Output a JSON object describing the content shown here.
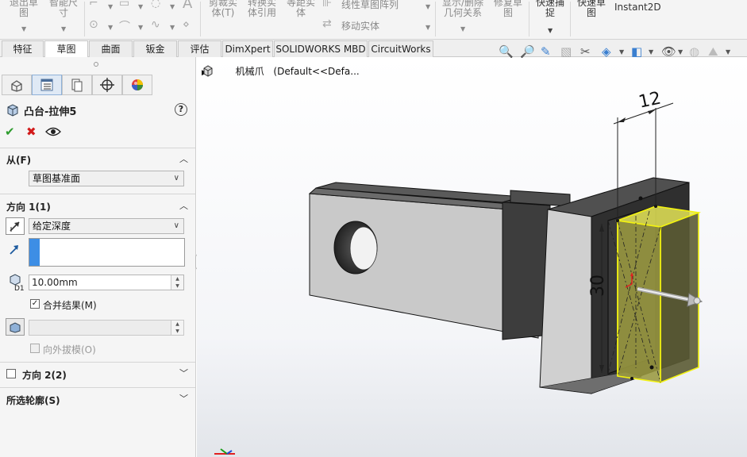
{
  "ribbon": {
    "exit_sketch": "退出草\n图",
    "smart_dim": "智能尺\n寸",
    "trim_entities": "剪裁实\n体(T)",
    "convert_entities": "转换实\n体引用",
    "offset_entities": "等距实\n体",
    "linear_pattern": "线性草图阵列",
    "move_entities": "移动实体",
    "display_relations": "显示/删除\n几何关系",
    "repair_sketch": "修复草\n图",
    "quick_snaps": "快速捕\n捉",
    "rapid_sketch": "快速草\n图",
    "instant2d": "Instant2D"
  },
  "tabs": [
    {
      "label": "特征"
    },
    {
      "label": "草图"
    },
    {
      "label": "曲面"
    },
    {
      "label": "钣金"
    },
    {
      "label": "评估"
    },
    {
      "label": "DimXpert"
    },
    {
      "label": "SOLIDWORKS MBD"
    },
    {
      "label": "CircuitWorks"
    }
  ],
  "panel": {
    "title": "凸台-拉伸5",
    "help": "?",
    "from": {
      "label": "从(F)",
      "value": "草图基准面"
    },
    "direction1": {
      "label": "方向 1(1)",
      "end_condition": "给定深度",
      "depth_value": "10.00mm",
      "depth_icon_label": "D1",
      "merge_label": "合并结果(M)",
      "merge_checked": true,
      "draft_outward_label": "向外拔模(O)"
    },
    "direction2": {
      "label": "方向 2(2)"
    },
    "selected_contours": {
      "label": "所选轮廓(S)"
    }
  },
  "viewport": {
    "tree_part_name": "机械爪",
    "tree_config": "(Default<<Defa...",
    "dim_width": "12",
    "dim_height": "30"
  },
  "colors": {
    "accent_blue": "#3d8ee5",
    "ok_green": "#2e9c2e",
    "cancel_red": "#d21b1b",
    "preview_yellow": "#f2f210"
  }
}
